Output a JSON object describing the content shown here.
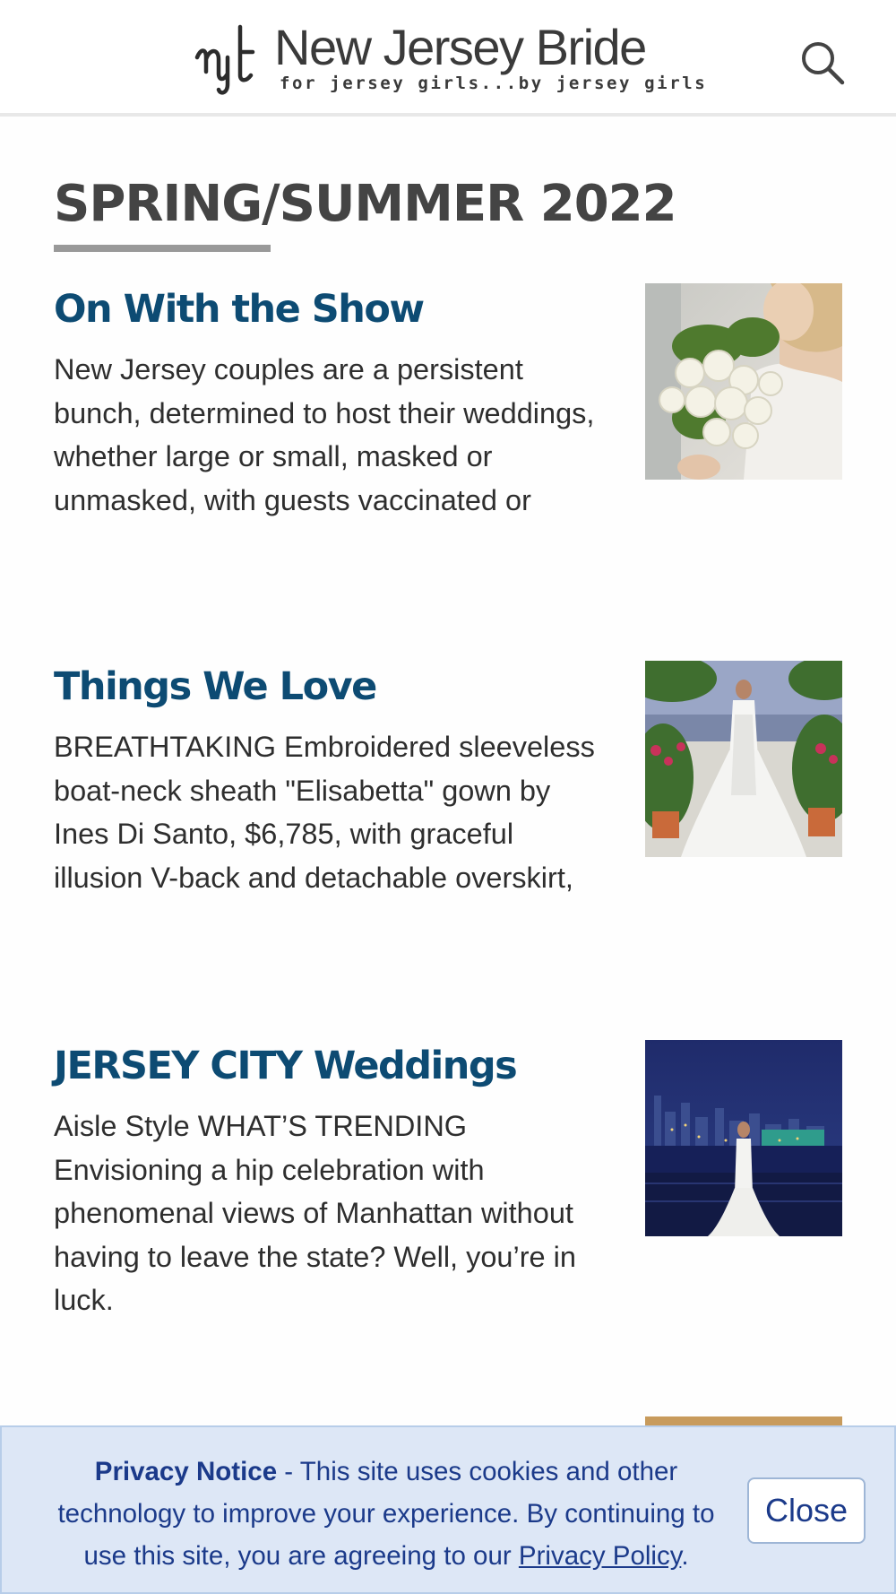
{
  "header": {
    "logo_title": "New Jersey Bride",
    "logo_tagline": "for jersey girls...by jersey girls",
    "logo_icon": "njb-monogram-icon",
    "search_icon": "search-icon"
  },
  "section": {
    "title": "SPRING/SUMMER 2022"
  },
  "articles": [
    {
      "title": "On With the Show",
      "excerpt": "New Jersey couples are a persistent bunch, determined to host their weddings, whether large or small, masked or unmasked, with guests vaccinated or",
      "image": "bride-with-white-roses-bouquet"
    },
    {
      "title": "Things We Love",
      "excerpt": "BREATHTAKING Embroidered sleeveless boat-neck sheath \"Elisabetta\" gown by Ines Di Santo, $6,785, with graceful illusion V-back and detachable overskirt,",
      "image": "bride-in-garden-gown"
    },
    {
      "title": "JERSEY CITY Weddings",
      "excerpt": "Aisle Style WHAT’S TRENDING Envisioning a hip celebration with phenomenal views of Manhattan without having to leave the state? Well, you’re in luck.",
      "image": "bride-night-skyline"
    }
  ],
  "privacy_notice": {
    "heading": "Privacy Notice",
    "text": " - This site uses cookies and other technology to improve your experience. By continuing to use this site, you are agreeing to our ",
    "link_label": "Privacy Policy",
    "trailing": ".",
    "close_label": "Close"
  },
  "colors": {
    "headline_blue": "#0d4b73",
    "notice_bg": "#dde7f6",
    "notice_text": "#1b3a8a"
  }
}
